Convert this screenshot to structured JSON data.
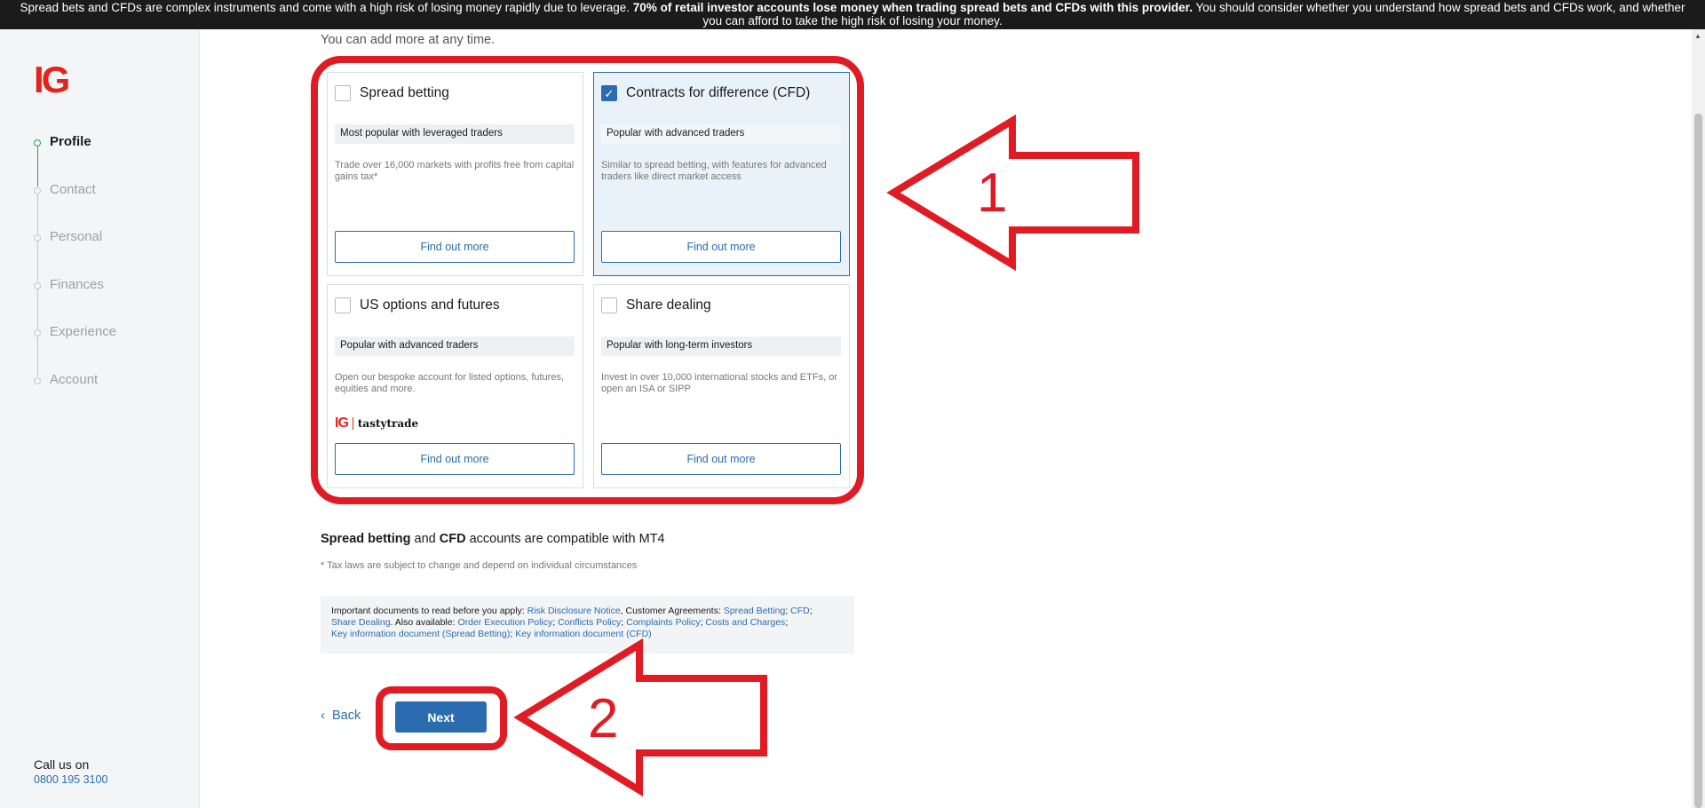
{
  "risk_banner": {
    "part1": "Spread bets and CFDs are complex instruments and come with a high risk of losing money rapidly due to leverage. ",
    "bold": "70% of retail investor accounts lose money when trading spread bets and CFDs with this provider.",
    "part2": " You should consider whether you understand how spread bets and CFDs work, and whether you can afford to take the high risk of losing your money."
  },
  "logo": "IG",
  "steps": [
    {
      "label": "Profile",
      "active": true
    },
    {
      "label": "Contact",
      "active": false
    },
    {
      "label": "Personal",
      "active": false
    },
    {
      "label": "Finances",
      "active": false
    },
    {
      "label": "Experience",
      "active": false
    },
    {
      "label": "Account",
      "active": false
    }
  ],
  "callus": {
    "label": "Call us on",
    "phone": "0800 195 3100"
  },
  "intro": "You can add more at any time.",
  "cards": [
    {
      "title": "Spread betting",
      "checked": false,
      "tag": "Most popular with leveraged traders",
      "desc": "Trade over 16,000 markets with profits free from capital gains tax*",
      "button": "Find out more"
    },
    {
      "title": "Contracts for difference (CFD)",
      "checked": true,
      "tag": "Popular with advanced traders",
      "desc": "Similar to spread betting, with features for advanced traders like direct market access",
      "button": "Find out more"
    },
    {
      "title": "US options and futures",
      "checked": false,
      "tag": "Popular with advanced traders",
      "desc": "Open our bespoke account for listed options, futures, equities and more.",
      "button": "Find out more",
      "partner": {
        "ig": "IG",
        "tasty": "tastytrade"
      }
    },
    {
      "title": "Share dealing",
      "checked": false,
      "tag": "Popular with long-term investors",
      "desc": "Invest in over 10,000 international stocks and ETFs, or open an ISA or SIPP",
      "button": "Find out more"
    }
  ],
  "compat": {
    "a": "Spread betting",
    "and": " and ",
    "b": "CFD",
    "rest": " accounts are compatible with MT4"
  },
  "taxnote": "* Tax laws are subject to change and depend on individual circumstances",
  "docs": {
    "lead": "Important documents to read before you apply: ",
    "risk": "Risk Disclosure Notice",
    "agreements": ", Customer Agreements: ",
    "spread": "Spread Betting",
    "sep1": "; ",
    "cfd": "CFD",
    "sep2": "; ",
    "share": "Share Dealing",
    "also": ". Also available: ",
    "order": "Order Execution Policy",
    "sep3": "; ",
    "conflicts": "Conflicts Policy",
    "sep4": "; ",
    "complaints": "Complaints Policy",
    "sep5": "; ",
    "costs": "Costs and Charges",
    "sep6": ";",
    "kid_sb": "Key information document (Spread Betting)",
    "sep7": "; ",
    "kid_cfd": "Key information document (CFD)"
  },
  "nav": {
    "back": "Back",
    "next": "Next"
  },
  "annotations": {
    "label1": "1",
    "label2": "2",
    "color": "#e11b24"
  },
  "colors": {
    "brand": "#e1251b",
    "accent": "#2b6cb0",
    "banner": "#1b1b1b"
  },
  "icons": {
    "checkbox_checked": "check-icon",
    "back": "chevron-left-icon"
  }
}
